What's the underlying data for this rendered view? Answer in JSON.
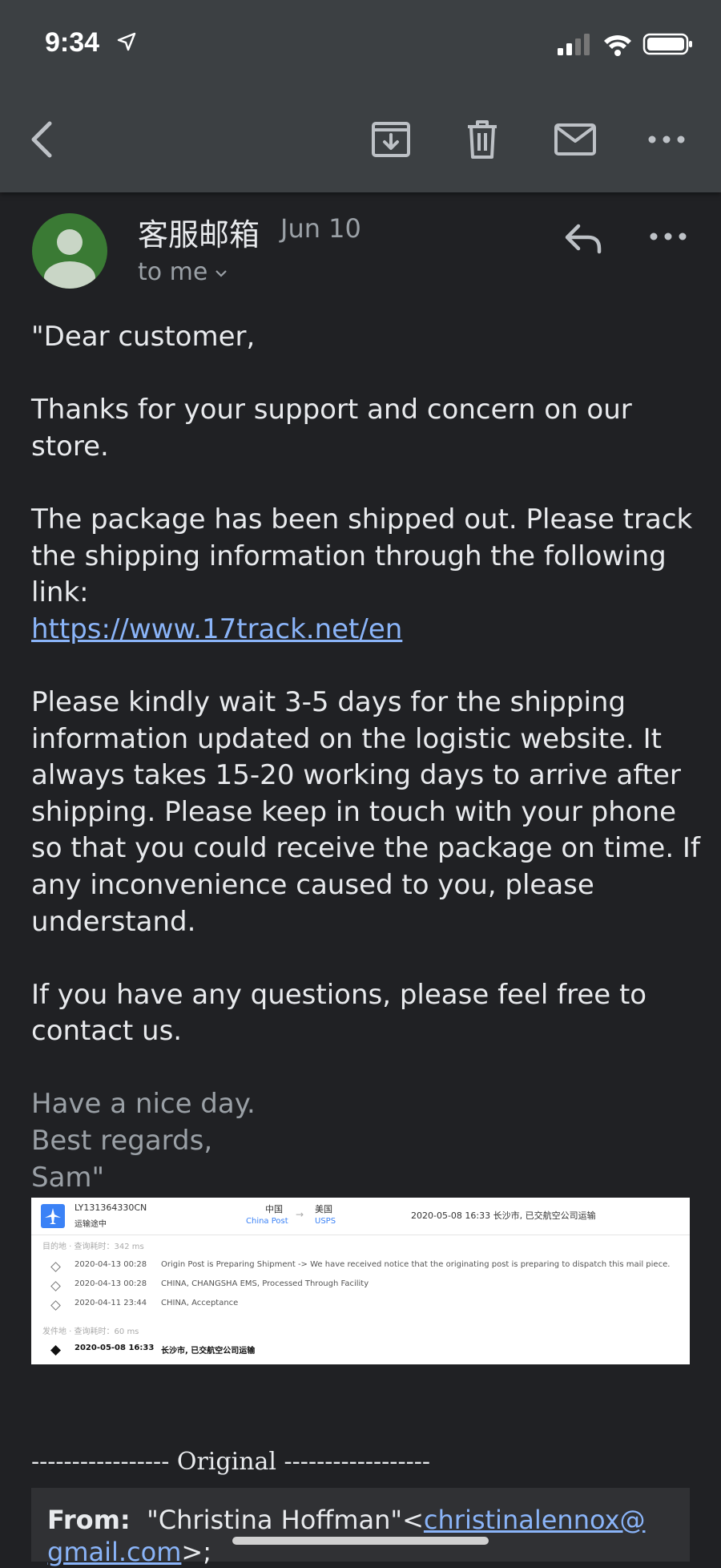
{
  "status": {
    "time": "9:34"
  },
  "toolbar": {
    "back": "back-arrow-icon",
    "archive": "archive-icon",
    "delete": "trash-icon",
    "mark_unread": "mail-icon",
    "more": "more-icon"
  },
  "message": {
    "sender": "客服邮箱",
    "date": "Jun 10",
    "to": "to me",
    "paragraphs": [
      "\"Dear customer,",
      "Thanks for your support and concern on our store.",
      "The package has been shipped out. Please track the shipping information through the following link:",
      "Please kindly wait 3-5 days for the shipping information updated on the logistic website. It always takes 15-20 working days to arrive after shipping. Please keep in touch with your phone so that you could receive the package on time. If any inconvenience caused to you, please understand.",
      "If you have any questions, please feel free to contact us."
    ],
    "link": "https://www.17track.net/en",
    "sign_off": [
      "Have a nice day.",
      "Best regards,",
      "Sam\""
    ]
  },
  "tracking": {
    "number": "LY131364330CN",
    "status": "运输途中",
    "origin_country": "中国",
    "origin_carrier": "China Post",
    "dest_country": "美国",
    "dest_carrier": "USPS",
    "latest": "2020-05-08 16:33  长沙市, 已交航空公司运输",
    "dest_section": "目的地 · 查询耗时：342 ms",
    "origin_section": "发件地 · 查询耗时：60 ms",
    "events": [
      {
        "date": "2020-04-13 00:28",
        "desc": "Origin Post is Preparing Shipment -> We have received notice that the originating post is preparing to dispatch this mail piece."
      },
      {
        "date": "2020-04-13 00:28",
        "desc": "CHINA, CHANGSHA EMS, Processed Through Facility"
      },
      {
        "date": "2020-04-11 23:44",
        "desc": "CHINA, Acceptance"
      }
    ],
    "origin_event": {
      "date": "2020-05-08 16:33",
      "desc": "长沙市, 已交航空公司运输"
    }
  },
  "original": {
    "divider": "----------------- Original ------------------",
    "from_label": "From:",
    "from_name": "\"Christina Hoffman\"<",
    "from_email_1": "christinalennox@",
    "from_email_2": "gmail.com",
    "from_tail": ">;"
  }
}
